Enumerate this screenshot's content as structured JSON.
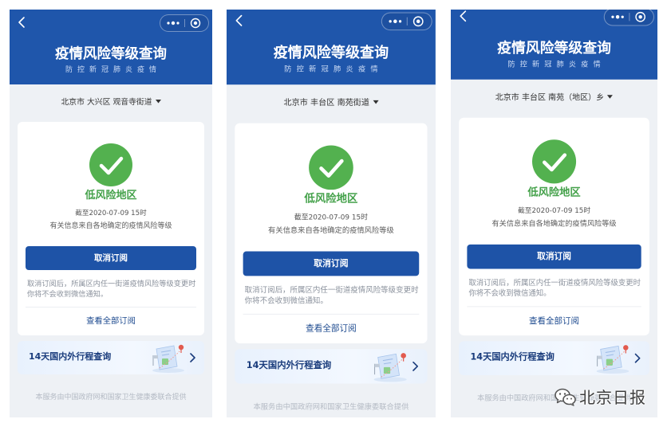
{
  "theme": {
    "header-blue": "#1f56ab",
    "screen-bg": "#eef1f5",
    "check-green": "#53b14f",
    "level-green": "#44a14a",
    "button-blue": "#1e53a7",
    "link-navy": "#1d4a8f",
    "trip-navy": "#1a3c7c"
  },
  "panels": [
    {
      "header": {
        "title": "疫情风险等级查询",
        "subtitle": "防控新冠肺炎疫情",
        "icons": [
          "chevron-left-icon",
          "more-dots-icon",
          "close-target-icon"
        ]
      },
      "location": {
        "value": "北京市 大兴区 观音寺街道",
        "icon": "dropdown-caret-icon"
      },
      "risk": {
        "icon": "check-circle-icon",
        "level": "低风险地区",
        "as_of": "截至2020-07-09 15时",
        "source_note": "有关信息来自各地确定的疫情风险等级"
      },
      "unsubscribe": {
        "label": "取消订阅",
        "note_lines": [
          "取消订阅后，所属区内任一街道疫情风险等级变更时",
          "你将不会收到微信通知。"
        ]
      },
      "view_all_label": "查看全部订阅",
      "trip": {
        "label": "14天国内外行程查询",
        "icons": [
          "itinerary-illustration",
          "chevron-right-icon"
        ]
      },
      "footer": "本服务由中国政府网和国家卫生健康委联合提供"
    },
    {
      "header": {
        "title": "疫情风险等级查询",
        "subtitle": "防控新冠肺炎疫情",
        "icons": [
          "chevron-left-icon",
          "more-dots-icon",
          "close-target-icon"
        ]
      },
      "location": {
        "value": "北京市 丰台区 南苑街道",
        "icon": "dropdown-caret-icon"
      },
      "risk": {
        "icon": "check-circle-icon",
        "level": "低风险地区",
        "as_of": "截至2020-07-09 15时",
        "source_note": "有关信息来自各地确定的疫情风险等级"
      },
      "unsubscribe": {
        "label": "取消订阅",
        "note_lines": [
          "取消订阅后，所属区内任一街道疫情风险等级变更时",
          "你将不会收到微信通知。"
        ]
      },
      "view_all_label": "查看全部订阅",
      "trip": {
        "label": "14天国内外行程查询",
        "icons": [
          "itinerary-illustration",
          "chevron-right-icon"
        ]
      },
      "footer": "本服务由中国政府网和国家卫生健康委联合提供"
    },
    {
      "header": {
        "title": "疫情风险等级查询",
        "subtitle": "防控新冠肺炎疫情",
        "icons": [
          "chevron-left-icon",
          "more-dots-icon",
          "close-target-icon"
        ]
      },
      "location": {
        "value": "北京市 丰台区 南苑（地区）乡",
        "icon": "dropdown-caret-icon"
      },
      "risk": {
        "icon": "check-circle-icon",
        "level": "低风险地区",
        "as_of": "截至2020-07-09 15时",
        "source_note": "有关信息来自各地确定的疫情风险等级"
      },
      "unsubscribe": {
        "label": "取消订阅",
        "note_lines": [
          "取消订阅后，所属区内任一街道疫情风险等级变更时",
          "你将不会收到微信通知。"
        ]
      },
      "view_all_label": "查看全部订阅",
      "trip": {
        "label": "14天国内外行程查询",
        "icons": [
          "itinerary-illustration",
          "chevron-right-icon"
        ]
      },
      "footer": "本服务由中国政府网和国家卫生健康委联合提供"
    }
  ],
  "watermark": {
    "icon": "wechat-logo-icon",
    "label": "北京日报"
  }
}
